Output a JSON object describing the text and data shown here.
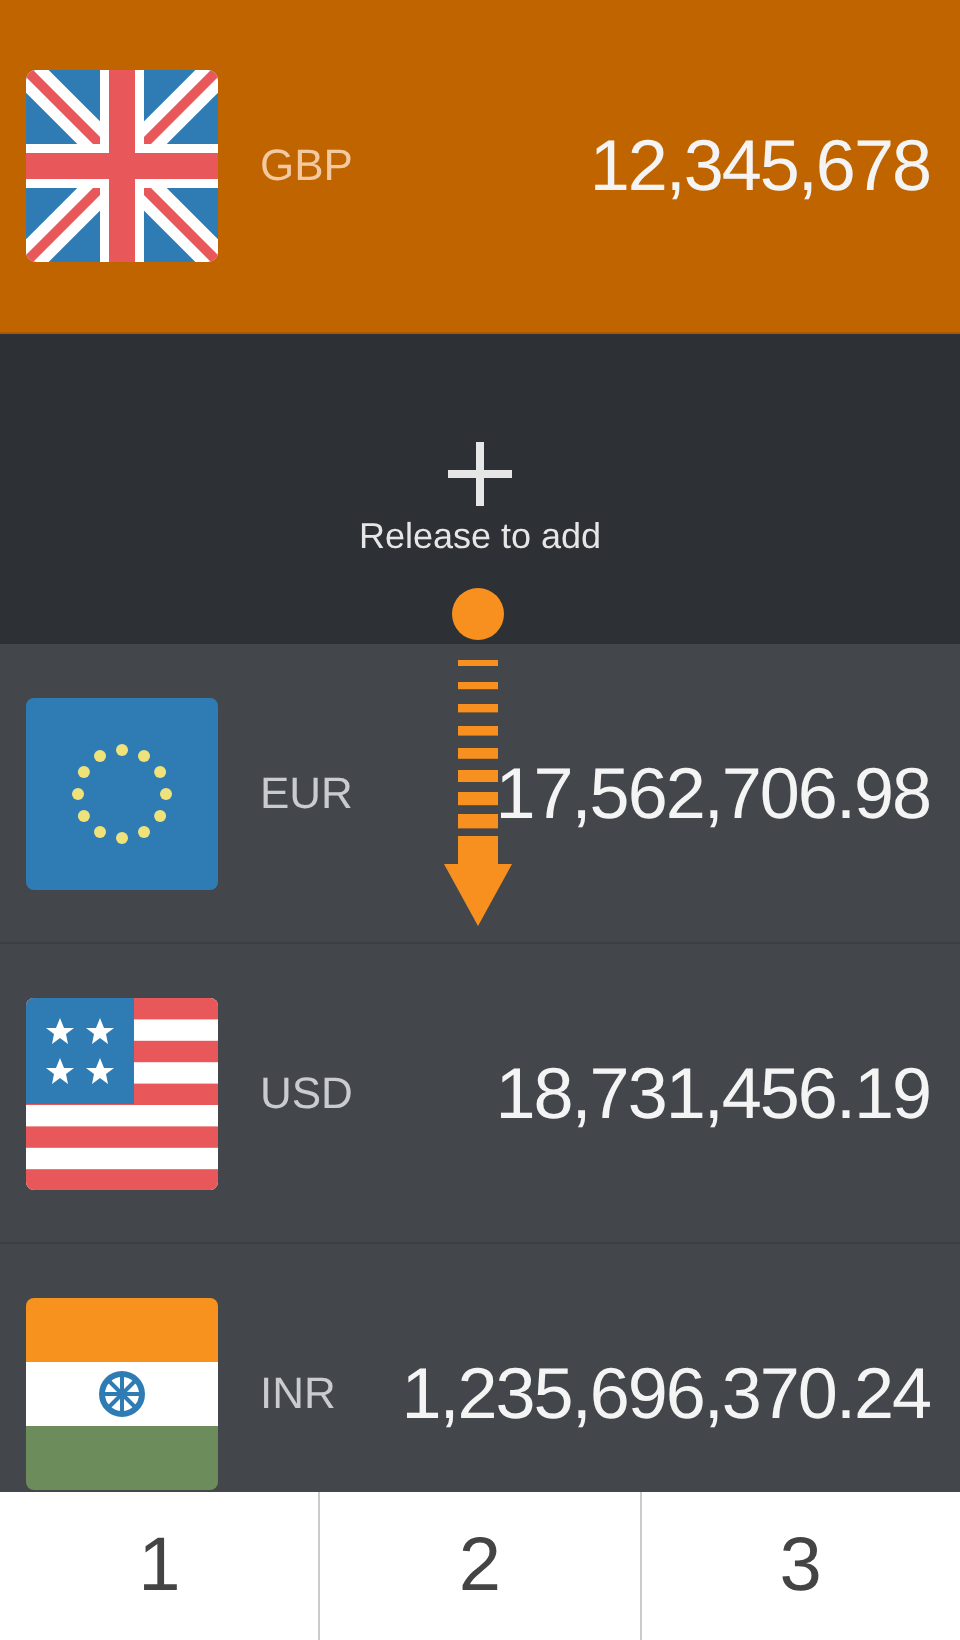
{
  "base": {
    "kind": "gb",
    "code": "GBP",
    "amount": "12,345,678"
  },
  "add_prompt": {
    "label": "Release to add"
  },
  "currencies": [
    {
      "kind": "eu",
      "code": "EUR",
      "amount": "17,562,706.98"
    },
    {
      "kind": "us",
      "code": "USD",
      "amount": "18,731,456.19"
    },
    {
      "kind": "in",
      "code": "INR",
      "amount": "1,235,696,370.24"
    }
  ],
  "tabs": [
    "1",
    "2",
    "3"
  ]
}
